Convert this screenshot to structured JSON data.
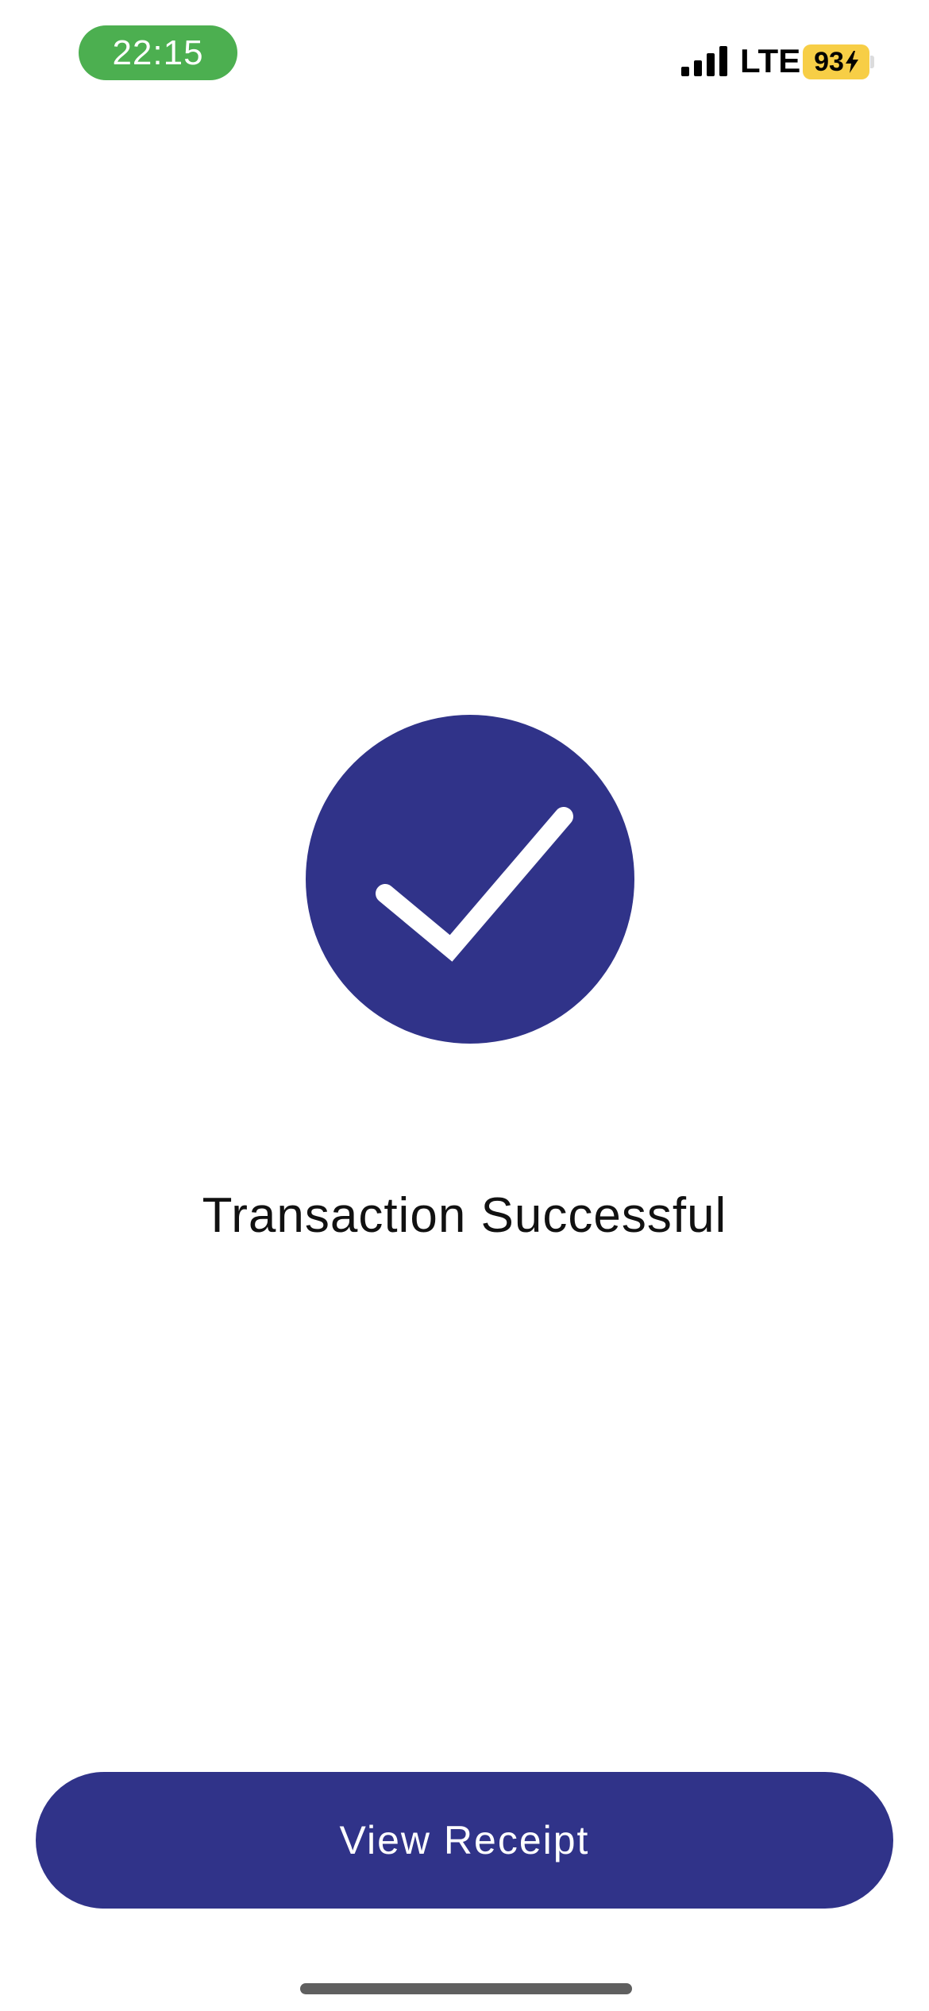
{
  "status_bar": {
    "time": "22:15",
    "network": "LTE",
    "battery_level": "93",
    "time_pill_color": "#4CAF50",
    "battery_color": "#F7CE46",
    "signal_icon": "cellular-signal-icon",
    "charging_icon": "bolt-icon"
  },
  "success": {
    "icon": "checkmark-icon",
    "circle_color": "#303389",
    "title": "Transaction Successful"
  },
  "actions": {
    "view_receipt_label": "View Receipt",
    "button_color": "#303389"
  }
}
